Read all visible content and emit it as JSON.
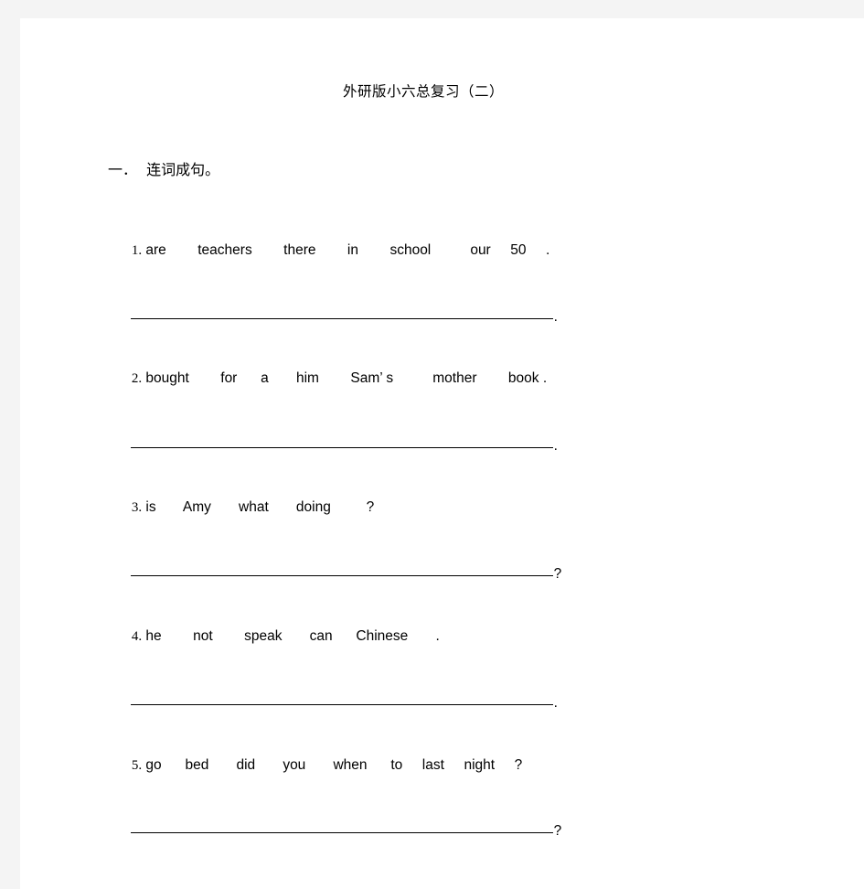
{
  "document": {
    "title": "外研版小六总复习（二）",
    "section_heading": "一．  连词成句。",
    "questions": [
      {
        "number": "1.",
        "words": " are        teachers        there        in        school          our     50     .",
        "blank_punct": "."
      },
      {
        "number": "2.",
        "words": " bought        for      a       him        Sam’ s          mother        book .",
        "blank_punct": "."
      },
      {
        "number": "3.",
        "words": " is       Amy       what       doing         ?",
        "blank_punct": "?"
      },
      {
        "number": "4.",
        "words": " he        not        speak       can      Chinese       .",
        "blank_punct": "."
      },
      {
        "number": "5.",
        "words": " go      bed       did       you       when      to     last     night     ?",
        "blank_punct": "?"
      }
    ]
  }
}
